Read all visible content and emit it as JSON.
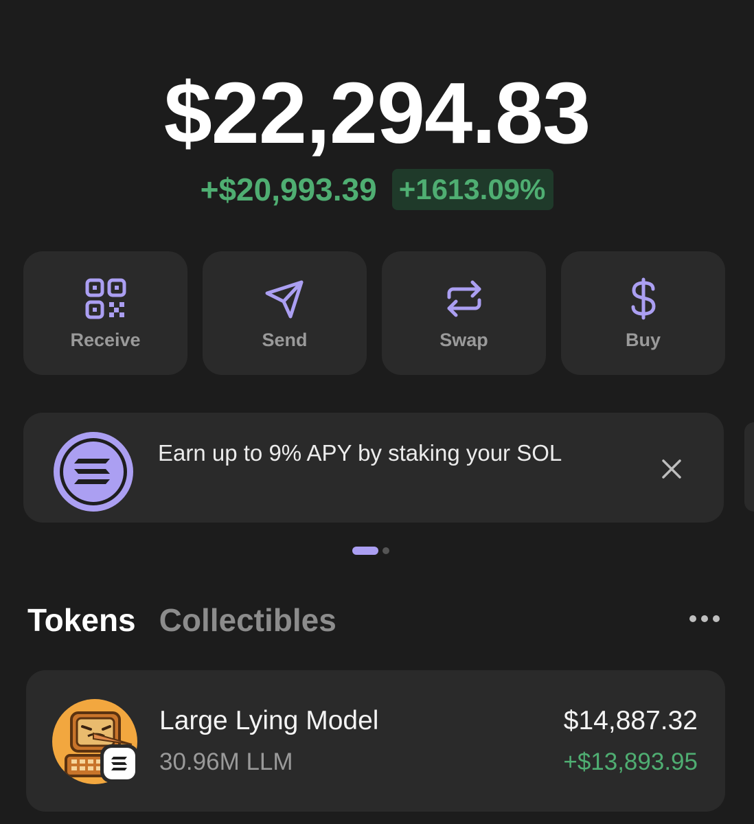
{
  "balance": "$22,294.83",
  "change": {
    "amount": "+$20,993.39",
    "percent": "+1613.09%"
  },
  "actions": [
    {
      "label": "Receive",
      "icon": "qr-code-icon"
    },
    {
      "label": "Send",
      "icon": "send-icon"
    },
    {
      "label": "Swap",
      "icon": "swap-icon"
    },
    {
      "label": "Buy",
      "icon": "dollar-icon"
    }
  ],
  "promo": {
    "text": "Earn up to 9% APY by staking your SOL",
    "icon": "solana-icon",
    "close_icon": "close-icon"
  },
  "carousel": {
    "page_count": 2,
    "active_index": 0
  },
  "tabs": [
    {
      "label": "Tokens",
      "active": true
    },
    {
      "label": "Collectibles",
      "active": false
    }
  ],
  "more_icon": "more-icon",
  "tokens": [
    {
      "name": "Large Lying Model",
      "amount": "30.96M LLM",
      "value": "$14,887.32",
      "change": "+$13,893.95",
      "icon": "token-avatar-icon",
      "chain_icon": "solana-icon"
    }
  ],
  "colors": {
    "background": "#1c1c1c",
    "card": "#2a2a2a",
    "accent": "#ab9ff2",
    "positive": "#4fae72",
    "positive_bg": "#1f3a2a",
    "muted": "#9a9a9a"
  }
}
